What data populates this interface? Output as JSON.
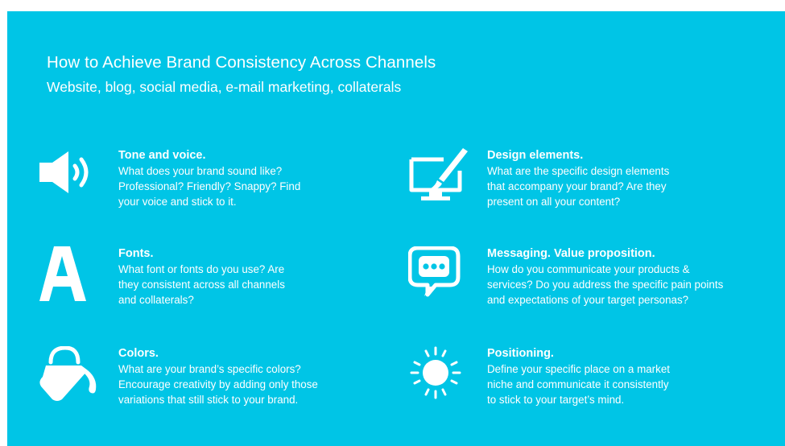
{
  "title": "How to Achieve Brand Consistency Across Channels",
  "subtitle": "Website, blog, social media, e-mail marketing, collaterals",
  "items": [
    {
      "heading": "Tone and voice.",
      "lines": [
        "What does your brand sound like?",
        "Professional? Friendly? Snappy? Find",
        "your voice and stick to it."
      ],
      "icon": "speaker-icon"
    },
    {
      "heading": "Fonts.",
      "lines": [
        "What font or fonts do you use? Are",
        "they consistent across all channels",
        "and collaterals?"
      ],
      "icon": "letter-a-icon"
    },
    {
      "heading": "Colors.",
      "lines": [
        "What are your brand’s specific colors?",
        "Encourage creativity by adding only those",
        "variations that still stick to your brand."
      ],
      "icon": "paint-bucket-icon"
    },
    {
      "heading": "Design elements.",
      "lines": [
        "What are the specific design elements",
        "that accompany your brand? Are they",
        "present on all your content?"
      ],
      "icon": "monitor-brush-icon"
    },
    {
      "heading": "Messaging. Value proposition.",
      "lines": [
        "How do you communicate your products &",
        "services? Do you address the specific pain points",
        "and expectations of your target personas?"
      ],
      "icon": "chat-bubble-icon"
    },
    {
      "heading": "Positioning.",
      "lines": [
        "Define your specific place on a market",
        "niche and communicate it consistently",
        "to stick to your target’s mind."
      ],
      "icon": "sun-icon"
    }
  ],
  "colors": {
    "background": "#00c5e6",
    "foreground": "#ffffff",
    "page": "#ffffff"
  }
}
